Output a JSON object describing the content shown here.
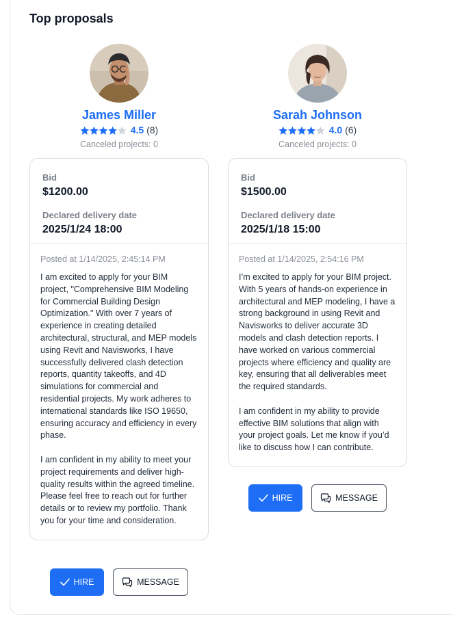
{
  "page": {
    "title": "Top proposals",
    "hire_label": "HIRE",
    "message_label": "MESSAGE"
  },
  "proposals": [
    {
      "name": "James Miller",
      "rating": "4.5",
      "reviews": "(8)",
      "rating_value": 4.5,
      "canceled": "Canceled projects: 0",
      "bid_label": "Bid",
      "bid": "$1200.00",
      "date_label": "Declared delivery date",
      "date": "2025/1/24 18:00",
      "posted": "Posted at 1/14/2025, 2:45:14 PM",
      "paragraphs": [
        "I am excited to apply for your BIM project, \"Comprehensive BIM Modeling for Commercial Building Design Optimization.\" With over 7 years of experience in creating detailed architectural, structural, and MEP models using Revit and Navisworks, I have successfully delivered clash detection reports, quantity takeoffs, and 4D simulations for commercial and residential projects. My work adheres to international standards like ISO 19650, ensuring accuracy and efficiency in every phase.",
        "I am confident in my ability to meet your project requirements and deliver high-quality results within the agreed timeline. Please feel free to reach out for further details or to review my portfolio. Thank you for your time and consideration."
      ]
    },
    {
      "name": "Sarah Johnson",
      "rating": "4.0",
      "reviews": "(6)",
      "rating_value": 4.0,
      "canceled": "Canceled projects: 0",
      "bid_label": "Bid",
      "bid": "$1500.00",
      "date_label": "Declared delivery date",
      "date": "2025/1/18 15:00",
      "posted": "Posted at 1/14/2025, 2:54:16 PM",
      "paragraphs": [
        "I’m excited to apply for your BIM project. With 5 years of hands-on experience in architectural and MEP modeling, I have a strong background in using Revit and Navisworks to deliver accurate 3D models and clash detection reports. I have worked on various commercial projects where efficiency and quality are key, ensuring that all deliverables meet the required standards.",
        "I am confident in my ability to provide effective BIM solutions that align with your project goals. Let me know if you’d like to discuss how I can contribute."
      ]
    }
  ],
  "colors": {
    "accent": "#1d6ef5",
    "star_empty": "#cfd4dc"
  }
}
